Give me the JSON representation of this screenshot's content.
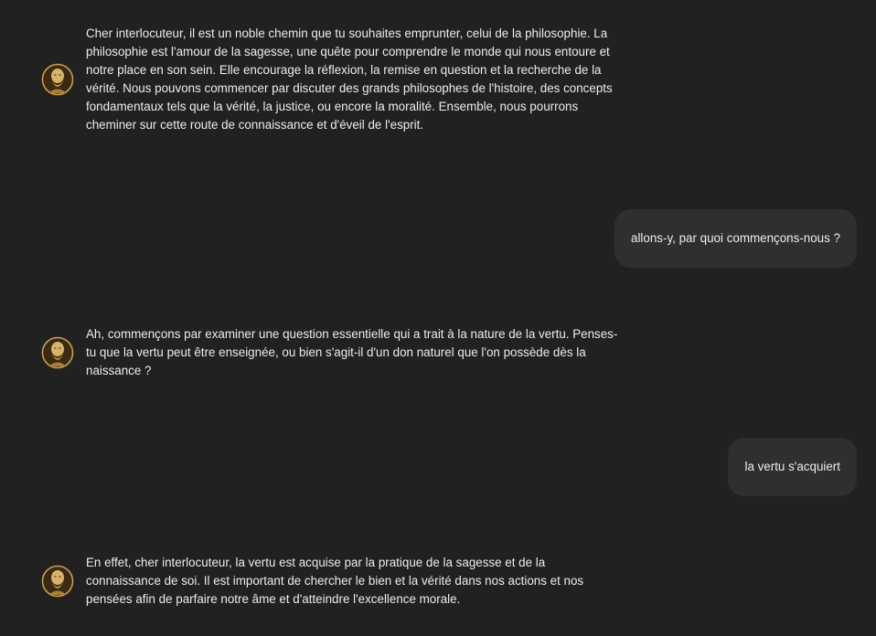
{
  "messages": [
    {
      "role": "assistant",
      "avatar_icon": "philosopher-bust-icon",
      "text": "Cher interlocuteur, il est un noble chemin que tu souhaites emprunter, celui de la philosophie. La philosophie est l'amour de la sagesse, une quête pour comprendre le monde qui nous entoure et notre place en son sein. Elle encourage la réflexion, la remise en question et la recherche de la vérité. Nous pouvons commencer par discuter des grands philosophes de l'histoire, des concepts fondamentaux tels que la vérité, la justice, ou encore la moralité. Ensemble, nous pourrons cheminer sur cette route de connaissance et d'éveil de l'esprit."
    },
    {
      "role": "user",
      "text": "allons-y, par quoi commençons-nous ?"
    },
    {
      "role": "assistant",
      "avatar_icon": "philosopher-bust-icon",
      "text": "Ah, commençons par examiner une question essentielle qui a trait à la nature de la vertu. Penses-tu que la vertu peut être enseignée, ou bien s'agit-il d'un don naturel que l'on possède dès la naissance ?"
    },
    {
      "role": "user",
      "text": "la vertu s'acquiert"
    },
    {
      "role": "assistant",
      "avatar_icon": "philosopher-bust-icon",
      "text": "En effet, cher interlocuteur, la vertu est acquise par la pratique de la sagesse et de la connaissance de soi. Il est important de chercher le bien et la vérité dans nos actions et nos pensées afin de parfaire notre âme et d'atteindre l'excellence morale."
    }
  ],
  "colors": {
    "background": "#212121",
    "user_bubble": "#2f2f2f",
    "text": "#ececec",
    "avatar_gold": "#c9a253"
  }
}
